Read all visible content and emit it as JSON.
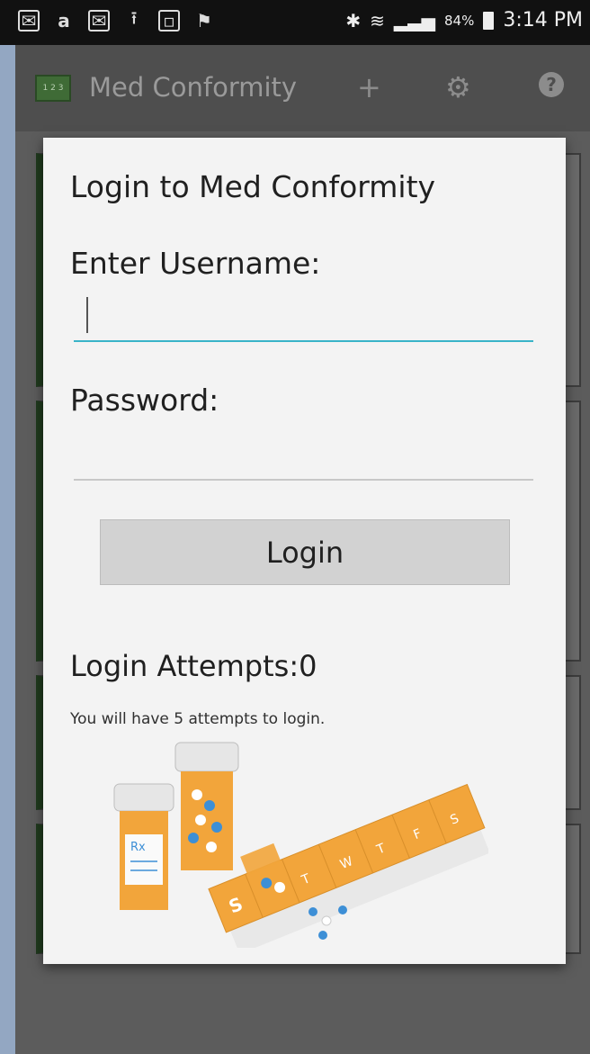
{
  "status_bar": {
    "left_icons": [
      "email-icon",
      "amazon-icon",
      "email-icon",
      "upload-icon",
      "image-icon",
      "flag-icon"
    ],
    "battery": "84%",
    "time": "3:14 PM"
  },
  "app_bar": {
    "title": "Med Conformity",
    "logo_text": "1 2 3",
    "actions": [
      "add-icon",
      "settings-icon",
      "help-icon"
    ]
  },
  "dialog": {
    "title": "Login to Med Conformity",
    "username_label": "Enter Username:",
    "username_value": "",
    "password_label": "Password:",
    "password_value": "",
    "login_button": "Login",
    "attempts_text": "Login Attempts:0",
    "note": "You will have 5 attempts to login."
  },
  "illustration": {
    "bottle_label": "Rx",
    "pillbox_days": [
      "S",
      "T",
      "W",
      "T",
      "F",
      "S"
    ]
  },
  "colors": {
    "accent": "#39b3c8",
    "pill_orange": "#f2a53b",
    "logo_green": "#3f6b36"
  }
}
